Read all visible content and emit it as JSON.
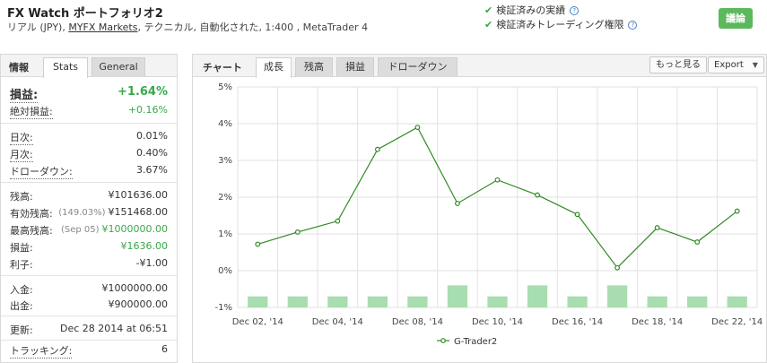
{
  "header": {
    "title": "FX Watch ポートフォリオ2",
    "sub_prefix": "リアル (JPY), ",
    "broker": "MYFX Markets",
    "sub_suffix": ", テクニカル, 自動化された, 1:400 , MetaTrader 4",
    "verify_track": "検証済みの実績",
    "verify_trading": "検証済みトレーディング権限",
    "discuss_button": "議論"
  },
  "left": {
    "section_label": "情報",
    "tabs": [
      "Stats",
      "General"
    ],
    "active_tab": "Stats",
    "gain_label": "損益:",
    "gain_value": "+1.64%",
    "abs_gain_label": "絶対損益:",
    "abs_gain_value": "+0.16%",
    "daily_label": "日次:",
    "daily_value": "0.01%",
    "monthly_label": "月次:",
    "monthly_value": "0.40%",
    "drawdown_label": "ドローダウン:",
    "drawdown_value": "3.67%",
    "balance_label": "残高:",
    "balance_value": "¥101636.00",
    "equity_label": "有効残高:",
    "equity_note": "(149.03%)",
    "equity_value": "¥151468.00",
    "highest_label": "最高残高:",
    "highest_note": "(Sep 05)",
    "highest_value": "¥1000000.00",
    "profit_label": "損益:",
    "profit_value": "¥1636.00",
    "interest_label": "利子:",
    "interest_value": "-¥1.00",
    "deposits_label": "入金:",
    "deposits_value": "¥1000000.00",
    "withdrawals_label": "出金:",
    "withdrawals_value": "¥900000.00",
    "updated_label": "更新:",
    "updated_value": "Dec 28 2014 at 06:51",
    "tracking_label": "トラッキング:",
    "tracking_value": "6"
  },
  "chart_panel": {
    "section_label": "チャート",
    "tabs": [
      "成長",
      "残高",
      "損益",
      "ドローダウン"
    ],
    "active_tab": "成長",
    "more_button": "もっと見る",
    "export_button": "Export",
    "colors": {
      "line": "#2e8b20",
      "bar": "#a8ddb0",
      "grid": "#e2e2e2"
    }
  },
  "chart_data": {
    "type": "line",
    "x": [
      "Dec 02, '14",
      "Dec 03, '14",
      "Dec 04, '14",
      "Dec 05, '14",
      "Dec 08, '14",
      "Dec 09, '14",
      "Dec 10, '14",
      "Dec 11, '14",
      "Dec 16, '14",
      "Dec 17, '14",
      "Dec 18, '14",
      "Dec 19, '14",
      "Dec 22, '14"
    ],
    "x_tick_labels": [
      "Dec 02, '14",
      "Dec 04, '14",
      "Dec 08, '14",
      "Dec 10, '14",
      "Dec 16, '14",
      "Dec 18, '14",
      "Dec 22, '14"
    ],
    "series": [
      {
        "name": "G-Trader2",
        "values": [
          0.72,
          1.05,
          1.35,
          3.3,
          3.9,
          1.83,
          2.47,
          2.06,
          1.53,
          0.08,
          1.17,
          0.78,
          1.62
        ]
      }
    ],
    "bars": [
      -0.7,
      -0.7,
      -0.7,
      -0.7,
      -0.7,
      -0.4,
      -0.7,
      -0.4,
      -0.7,
      -0.4,
      -0.7,
      -0.7,
      -0.7
    ],
    "ylim": [
      -1,
      5
    ],
    "y_ticks": [
      -1,
      0,
      1,
      2,
      3,
      4,
      5
    ],
    "y_tick_labels": [
      "-1%",
      "0%",
      "1%",
      "2%",
      "3%",
      "4%",
      "5%"
    ],
    "grid": true,
    "legend_position": "bottom-center"
  }
}
